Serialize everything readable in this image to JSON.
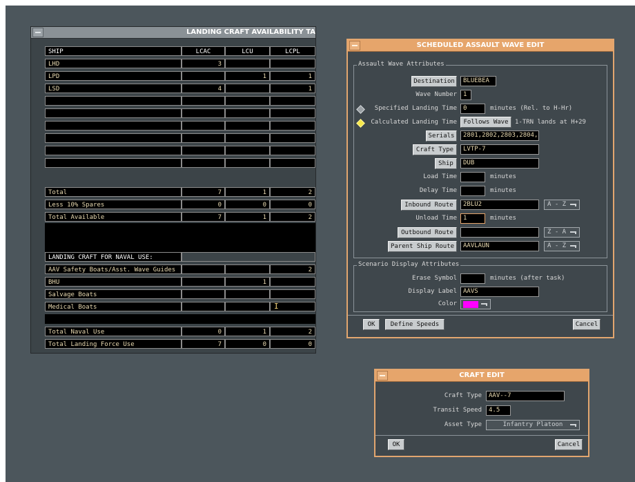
{
  "availability_window": {
    "title": "LANDING CRAFT AVAILABILITY TA",
    "headers": [
      "SHIP",
      "LCAC",
      "LCU",
      "LCPL"
    ],
    "ship_rows": [
      [
        "LHD",
        "3",
        "",
        ""
      ],
      [
        "LPD",
        "",
        "1",
        "1"
      ],
      [
        "LSD",
        "4",
        "",
        "1"
      ],
      [
        "",
        "",
        "",
        ""
      ],
      [
        "",
        "",
        "",
        ""
      ],
      [
        "",
        "",
        "",
        ""
      ],
      [
        "",
        "",
        "",
        ""
      ],
      [
        "",
        "",
        "",
        ""
      ],
      [
        "",
        "",
        "",
        ""
      ]
    ],
    "total_rows": [
      [
        "Total",
        "7",
        "1",
        "2"
      ],
      [
        "Less 10% Spares",
        "0",
        "0",
        "0"
      ],
      [
        "Total Available",
        "7",
        "1",
        "2"
      ]
    ],
    "naval_header": "LANDING CRAFT FOR NAVAL USE:",
    "naval_rows": [
      [
        "AAV Safety Boats/Asst. Wave Guides",
        "",
        "",
        "2"
      ],
      [
        "BHU",
        "",
        "1",
        ""
      ],
      [
        "Salvage Boats",
        "",
        "",
        ""
      ],
      [
        "Medical Boats",
        "",
        "",
        ""
      ]
    ],
    "final_rows": [
      [
        "Total Naval Use",
        "0",
        "1",
        "2"
      ],
      [
        "Total Landing Force Use",
        "7",
        "0",
        "0"
      ]
    ]
  },
  "wave_edit": {
    "title": "SCHEDULED ASSAULT WAVE EDIT",
    "group_assault": "Assault Wave Attributes",
    "destination_label": "Destination",
    "destination_value": "BLUEBEA",
    "wave_number_label": "Wave Number",
    "wave_number_value": "1",
    "specified_label": "Specified Landing Time",
    "specified_value": "0",
    "specified_units": "minutes (Rel. to H-Hr)",
    "calculated_label": "Calculated Landing Time",
    "follows_wave_label": "Follows Wave",
    "calculated_note": "1-TRN lands at H+29",
    "serials_label": "Serials",
    "serials_value": "2801,2802,2803,2804,",
    "craft_type_label": "Craft Type",
    "craft_type_value": "LVTP-7",
    "ship_label": "Ship",
    "ship_value": "DUB",
    "load_time_label": "Load Time",
    "load_time_value": "",
    "delay_time_label": "Delay Time",
    "delay_time_value": "",
    "minutes": "minutes",
    "inbound_label": "Inbound Route",
    "inbound_value": "2BLU2",
    "inbound_sort": "A - Z",
    "unload_label": "Unload Time",
    "unload_value": "1",
    "outbound_label": "Outbound Route",
    "outbound_value": "",
    "outbound_sort": "Z - A",
    "parent_label": "Parent Ship Route",
    "parent_value": "AAVLAUN",
    "parent_sort": "A - Z",
    "group_display": "Scenario Display Attributes",
    "erase_label": "Erase Symbol",
    "erase_value": "",
    "erase_units": "minutes (after task)",
    "display_label_label": "Display Label",
    "display_label_value": "AAVS",
    "color_label": "Color",
    "color_value": "#ff00ff",
    "ok": "OK",
    "define_speeds": "Define Speeds",
    "cancel": "Cancel"
  },
  "craft_edit": {
    "title": "CRAFT EDIT",
    "craft_type_label": "Craft Type",
    "craft_type_value": "AAV--7",
    "transit_label": "Transit Speed",
    "transit_value": "4.5",
    "asset_label": "Asset Type",
    "asset_value": "Infantry Platoon",
    "ok": "OK",
    "cancel": "Cancel"
  },
  "colors": {
    "desktop": "#4c565c",
    "dialog_title": "#e6a56b",
    "table_text": "#e8d9b0",
    "selected_diamond": "#f7e84a"
  }
}
